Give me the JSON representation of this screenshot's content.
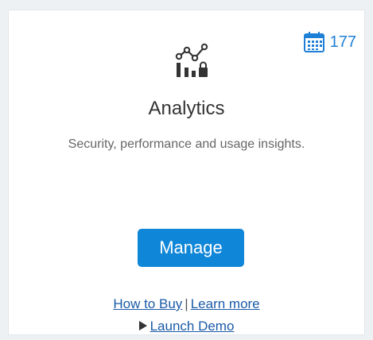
{
  "card": {
    "title": "Analytics",
    "subtitle": "Security, performance and usage insights.",
    "icon": "analytics-chart-lock-icon"
  },
  "badge": {
    "icon": "calendar-icon",
    "count": "177"
  },
  "actions": {
    "manage_label": "Manage",
    "how_to_buy": "How to Buy",
    "separator": "|",
    "learn_more": "Learn more",
    "launch_demo": "Launch Demo"
  },
  "colors": {
    "accent": "#0f86d8",
    "link": "#1a5aa6",
    "badge": "#1e7fd6"
  }
}
